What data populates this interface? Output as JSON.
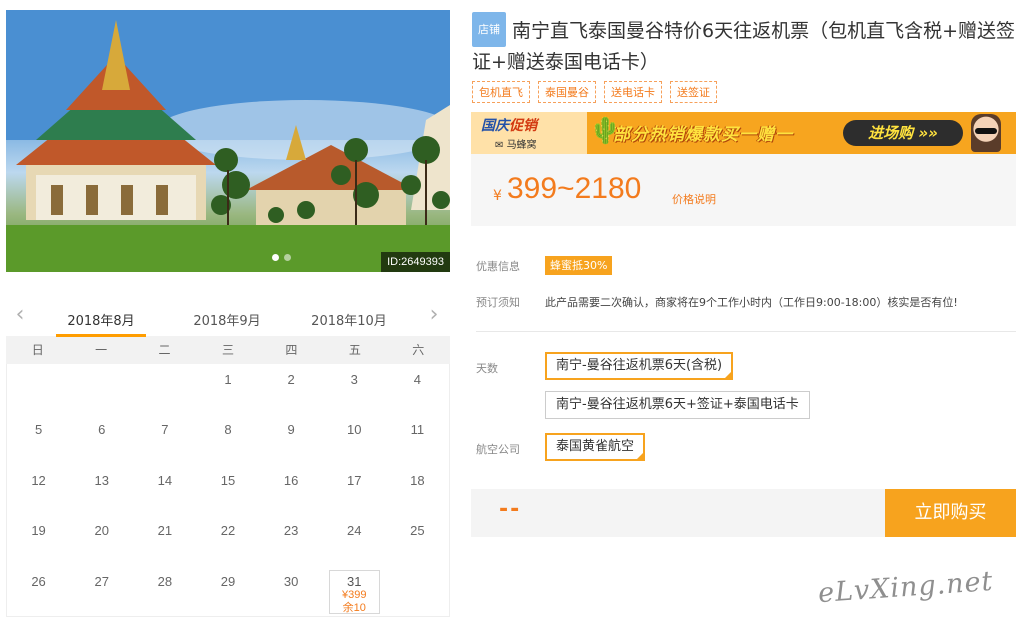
{
  "photo": {
    "id_label": "ID:2649393",
    "slides": 2,
    "active_slide": 0
  },
  "calendar": {
    "months": [
      "2018年8月",
      "2018年9月",
      "2018年10月"
    ],
    "active_month": 0,
    "weekdays": [
      "日",
      "一",
      "二",
      "三",
      "四",
      "五",
      "六"
    ],
    "weeks": [
      [
        "",
        "",
        "",
        "1",
        "2",
        "3",
        "4"
      ],
      [
        "5",
        "6",
        "7",
        "8",
        "9",
        "10",
        "11"
      ],
      [
        "12",
        "13",
        "14",
        "15",
        "16",
        "17",
        "18"
      ],
      [
        "19",
        "20",
        "21",
        "22",
        "23",
        "24",
        "25"
      ],
      [
        "26",
        "27",
        "28",
        "29",
        "30",
        "31",
        ""
      ]
    ],
    "available": {
      "day": "31",
      "price": "¥399",
      "stock": "余10"
    }
  },
  "product": {
    "shop_badge": "店铺",
    "title": "南宁直飞泰国曼谷特价6天往返机票（包机直飞含税+赠送签证+赠送泰国电话卡）",
    "tags": [
      "包机直飞",
      "泰国曼谷",
      "送电话卡",
      "送签证"
    ]
  },
  "banner": {
    "brand_a": "国庆",
    "brand_b": "促销",
    "brand_sub": "马蜂窝",
    "slogan": "部分热销爆款买一赠一",
    "cta": "进场购"
  },
  "price": {
    "currency": "¥",
    "range": "399~2180",
    "note": "价格说明"
  },
  "info": {
    "promo_label": "优惠信息",
    "promo_badge": "蜂蜜抵30%",
    "booking_label": "预订须知",
    "booking_text": "此产品需要二次确认，商家将在9个工作小时内（工作日9:00-18:00）核实是否有位!"
  },
  "options": {
    "days_label": "天数",
    "days": [
      "南宁-曼谷往返机票6天(含税)",
      "南宁-曼谷往返机票6天+签证+泰国电话卡"
    ],
    "days_selected": 0,
    "airline_label": "航空公司",
    "airlines": [
      "泰国黄雀航空"
    ],
    "airline_selected": 0
  },
  "buy": {
    "price_placeholder": "--",
    "button": "立即购买"
  },
  "watermark": "eLvXing.net",
  "colors": {
    "accent": "#f7a31e",
    "price": "#f37b1d",
    "badge_blue": "#7eb6ea"
  }
}
